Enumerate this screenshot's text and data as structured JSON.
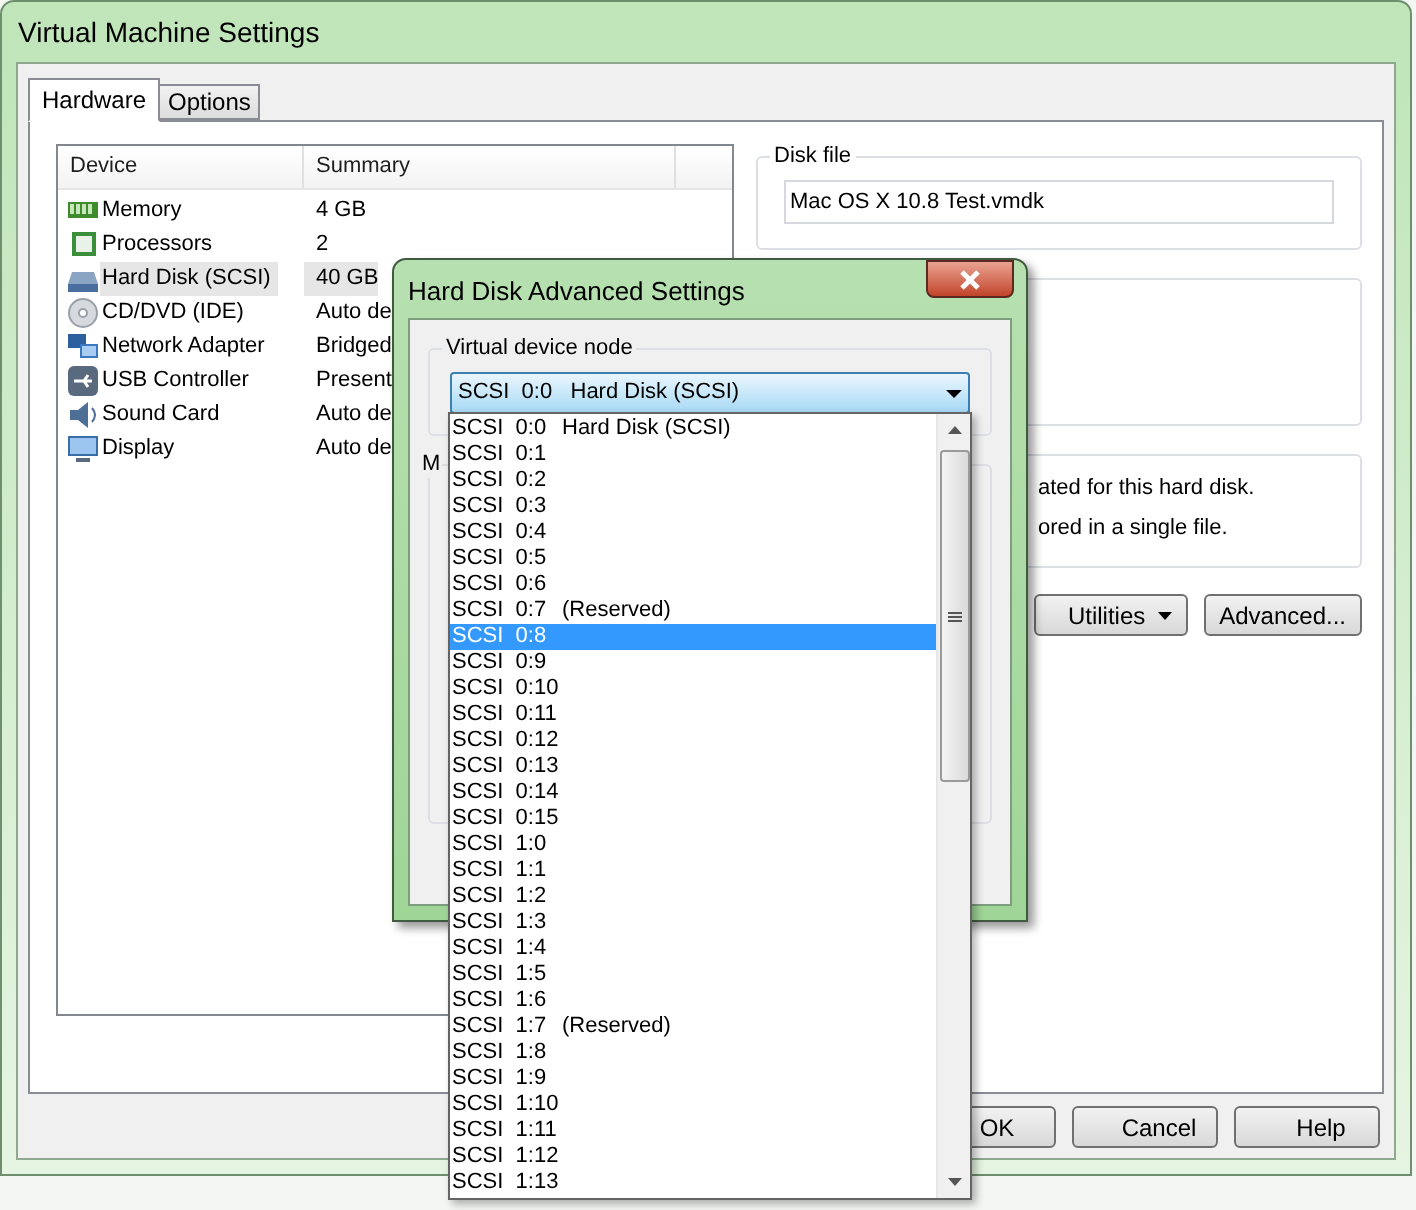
{
  "window": {
    "title": "Virtual Machine Settings"
  },
  "tabs": [
    {
      "label": "Hardware",
      "selected": true
    },
    {
      "label": "Options",
      "selected": false
    }
  ],
  "device_table": {
    "columns": [
      "Device",
      "Summary"
    ],
    "rows": [
      {
        "kind": "memory",
        "device": "Memory",
        "summary": "4 GB",
        "selected": false
      },
      {
        "kind": "processor",
        "device": "Processors",
        "summary": "2",
        "selected": false
      },
      {
        "kind": "disk",
        "device": "Hard Disk (SCSI)",
        "summary": "40 GB",
        "selected": true
      },
      {
        "kind": "cd",
        "device": "CD/DVD (IDE)",
        "summary": "Auto de",
        "selected": false
      },
      {
        "kind": "network",
        "device": "Network Adapter",
        "summary": "Bridged",
        "selected": false
      },
      {
        "kind": "usb",
        "device": "USB Controller",
        "summary": "Present",
        "selected": false
      },
      {
        "kind": "sound",
        "device": "Sound Card",
        "summary": "Auto de",
        "selected": false
      },
      {
        "kind": "display",
        "device": "Display",
        "summary": "Auto de",
        "selected": false
      }
    ]
  },
  "disk_file": {
    "label": "Disk file",
    "value": "Mac OS X 10.8 Test.vmdk"
  },
  "disk_info": {
    "lines": [
      "ated for this hard disk.",
      "ored in a single file."
    ]
  },
  "panel_buttons": [
    {
      "label": "Utilities",
      "dropdown": true
    },
    {
      "label": "Advanced...",
      "dropdown": false
    }
  ],
  "footer_buttons": [
    "OK",
    "Cancel",
    "Help"
  ],
  "dialog": {
    "title": "Hard Disk Advanced Settings",
    "node_group": {
      "label": "Virtual device node",
      "value": "SCSI  0:0   Hard Disk (SCSI)"
    },
    "mode_group_label": "M",
    "options": [
      {
        "node": "SCSI  0:0",
        "device": "Hard Disk (SCSI)",
        "selected": false
      },
      {
        "node": "SCSI  0:1",
        "selected": false
      },
      {
        "node": "SCSI  0:2",
        "selected": false
      },
      {
        "node": "SCSI  0:3",
        "selected": false
      },
      {
        "node": "SCSI  0:4",
        "selected": false
      },
      {
        "node": "SCSI  0:5",
        "selected": false
      },
      {
        "node": "SCSI  0:6",
        "selected": false
      },
      {
        "node": "SCSI  0:7",
        "device": "(Reserved)",
        "selected": false
      },
      {
        "node": "SCSI  0:8",
        "selected": true
      },
      {
        "node": "SCSI  0:9",
        "selected": false
      },
      {
        "node": "SCSI  0:10",
        "selected": false
      },
      {
        "node": "SCSI  0:11",
        "selected": false
      },
      {
        "node": "SCSI  0:12",
        "selected": false
      },
      {
        "node": "SCSI  0:13",
        "selected": false
      },
      {
        "node": "SCSI  0:14",
        "selected": false
      },
      {
        "node": "SCSI  0:15",
        "selected": false
      },
      {
        "node": "SCSI  1:0",
        "selected": false
      },
      {
        "node": "SCSI  1:1",
        "selected": false
      },
      {
        "node": "SCSI  1:2",
        "selected": false
      },
      {
        "node": "SCSI  1:3",
        "selected": false
      },
      {
        "node": "SCSI  1:4",
        "selected": false
      },
      {
        "node": "SCSI  1:5",
        "selected": false
      },
      {
        "node": "SCSI  1:6",
        "selected": false
      },
      {
        "node": "SCSI  1:7",
        "device": "(Reserved)",
        "selected": false
      },
      {
        "node": "SCSI  1:8",
        "selected": false
      },
      {
        "node": "SCSI  1:9",
        "selected": false
      },
      {
        "node": "SCSI  1:10",
        "selected": false
      },
      {
        "node": "SCSI  1:11",
        "selected": false
      },
      {
        "node": "SCSI  1:12",
        "selected": false
      },
      {
        "node": "SCSI  1:13",
        "selected": false
      }
    ]
  }
}
